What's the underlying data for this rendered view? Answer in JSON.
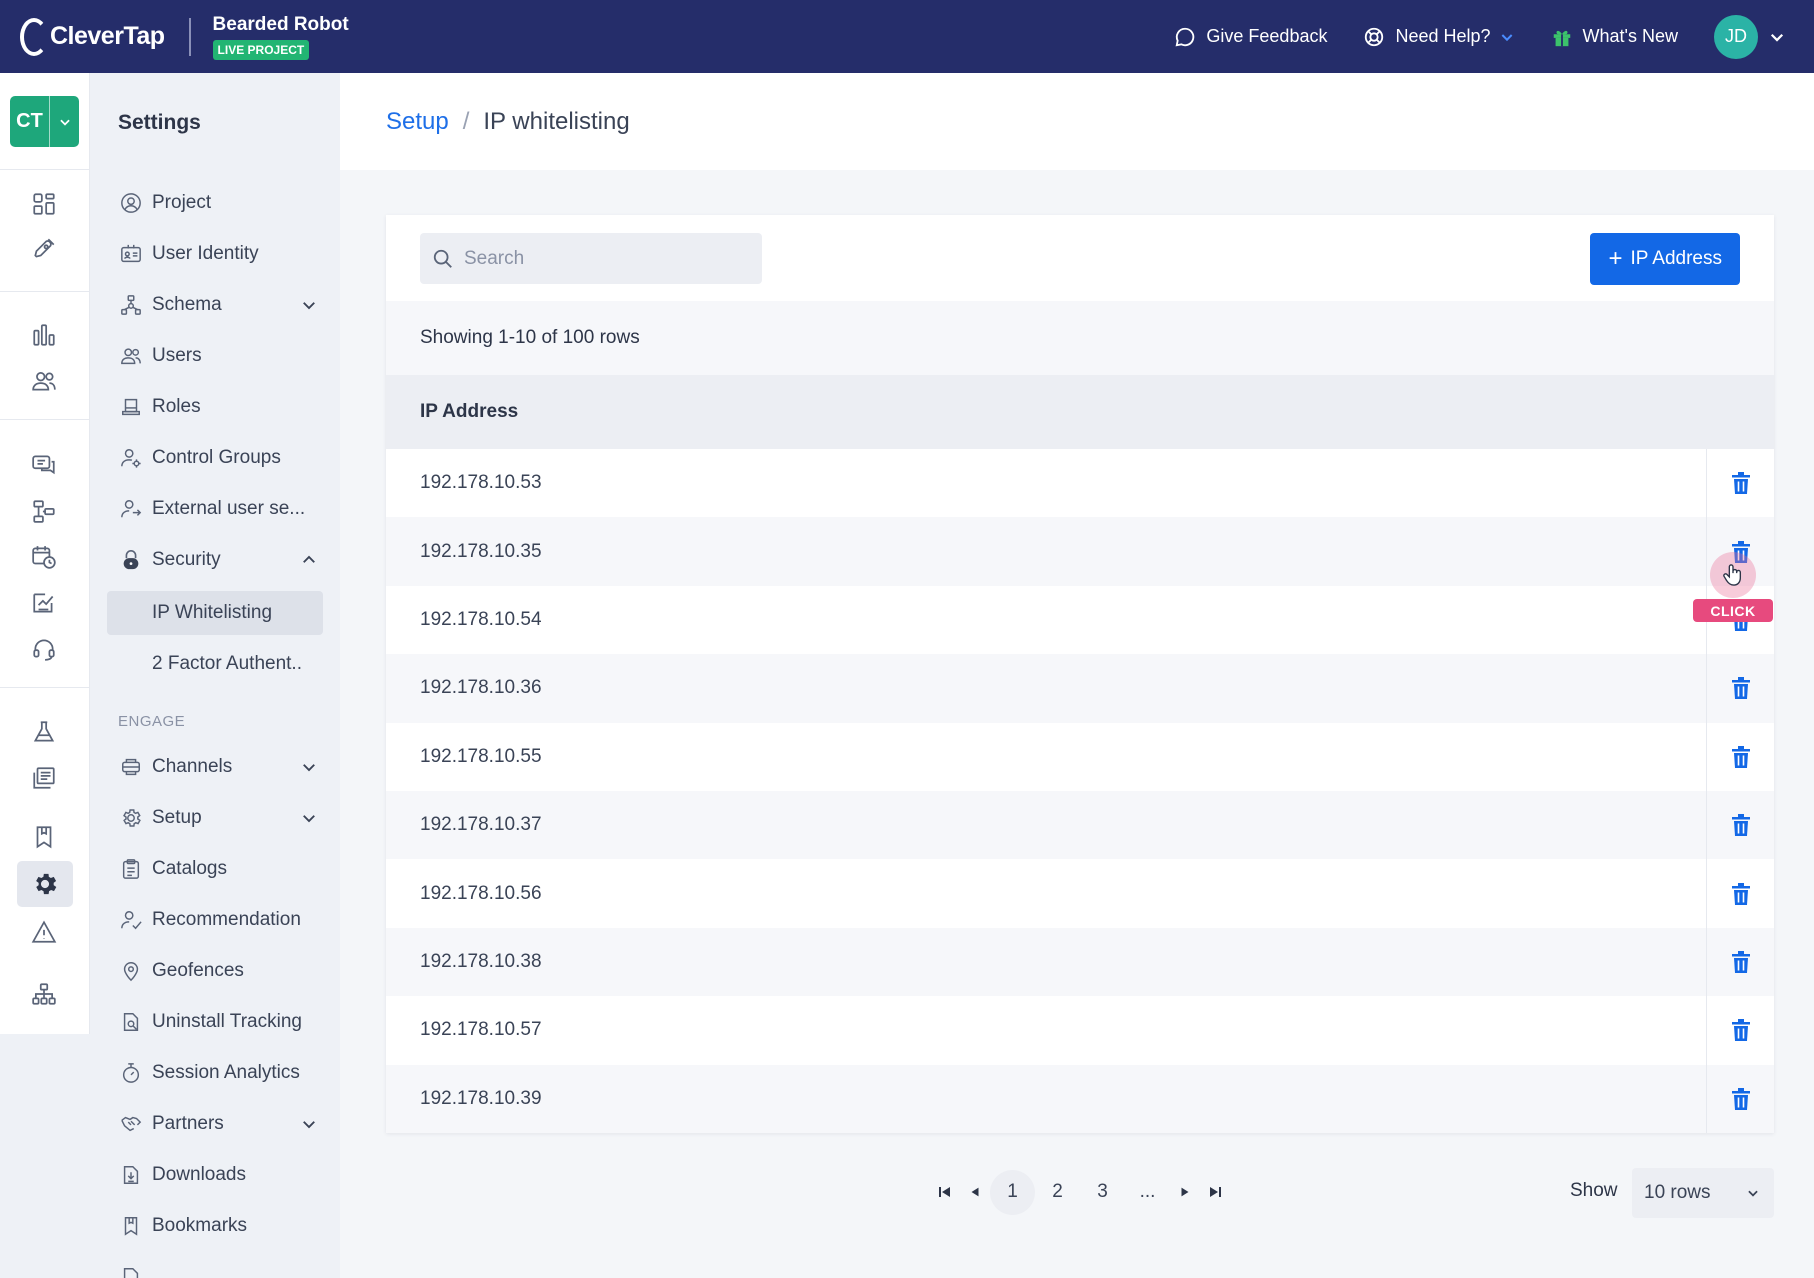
{
  "topbar": {
    "logo": "CleverTap",
    "project_name": "Bearded Robot",
    "project_badge": "LIVE PROJECT",
    "feedback": "Give Feedback",
    "help": "Need Help?",
    "whats_new": "What's New",
    "avatar_initials": "JD"
  },
  "rail": {
    "switcher": "CT",
    "icons": [
      "dashboard-icon",
      "rocket-icon",
      "analytics-icon",
      "segments-icon",
      "messages-icon",
      "journeys-icon",
      "scheduled-icon",
      "campaigns-icon",
      "support-icon",
      "experiments-icon",
      "catalog-icon",
      "bookmark-icon",
      "settings-icon",
      "alert-icon",
      "hierarchy-icon"
    ]
  },
  "sidebar": {
    "title": "Settings",
    "items": [
      {
        "label": "Project"
      },
      {
        "label": "User Identity"
      },
      {
        "label": "Schema"
      },
      {
        "label": "Users"
      },
      {
        "label": "Roles"
      },
      {
        "label": "Control Groups"
      },
      {
        "label": "External user se..."
      },
      {
        "label": "Security"
      }
    ],
    "security_sub": [
      {
        "label": "IP Whitelisting"
      },
      {
        "label": "2 Factor Authent.."
      }
    ],
    "section_engage": "ENGAGE",
    "engage_items": [
      {
        "label": "Channels"
      },
      {
        "label": "Setup"
      },
      {
        "label": "Catalogs"
      },
      {
        "label": "Recommendation"
      },
      {
        "label": "Geofences"
      },
      {
        "label": "Uninstall Tracking"
      },
      {
        "label": "Session Analytics"
      },
      {
        "label": "Partners"
      },
      {
        "label": "Downloads"
      },
      {
        "label": "Bookmarks"
      }
    ]
  },
  "breadcrumb": {
    "parent": "Setup",
    "separator": "/",
    "current": "IP whitelisting"
  },
  "toolbar": {
    "search_placeholder": "Search",
    "add_label": "IP Address",
    "add_plus": "+"
  },
  "table": {
    "info": "Showing 1-10 of 100 rows",
    "header": "IP Address",
    "rows": [
      {
        "ip": "192.178.10.53"
      },
      {
        "ip": "192.178.10.35"
      },
      {
        "ip": "192.178.10.54"
      },
      {
        "ip": "192.178.10.36"
      },
      {
        "ip": "192.178.10.55"
      },
      {
        "ip": "192.178.10.37"
      },
      {
        "ip": "192.178.10.56"
      },
      {
        "ip": "192.178.10.38"
      },
      {
        "ip": "192.178.10.57"
      },
      {
        "ip": "192.178.10.39"
      }
    ]
  },
  "pagination": {
    "pages": [
      "1",
      "2",
      "3",
      "..."
    ],
    "current": "1",
    "show_label": "Show",
    "rows_value": "10 rows"
  },
  "overlay": {
    "click_label": "CLICK"
  },
  "colors": {
    "topbar": "#252d6a",
    "accent": "#1368e6",
    "link": "#1e6fe8",
    "live_badge": "#22b573",
    "switcher": "#1ea77b",
    "click_tag": "#e74a7e"
  }
}
